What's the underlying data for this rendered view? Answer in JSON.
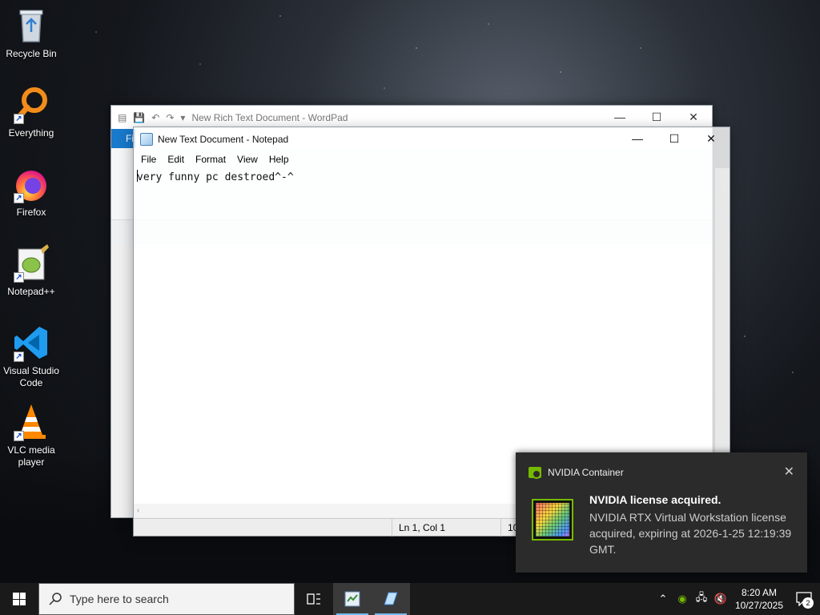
{
  "desktop": {
    "icons": [
      {
        "label": "Recycle Bin"
      },
      {
        "label": "Everything"
      },
      {
        "label": "Firefox"
      },
      {
        "label": "Notepad++"
      },
      {
        "label": "Visual Studio Code"
      },
      {
        "label": "VLC media player"
      }
    ]
  },
  "wordpad": {
    "title": "New Rich Text Document - WordPad",
    "file_tab": "Fi"
  },
  "notepad": {
    "title": "New Text Document - Notepad",
    "menu": [
      "File",
      "Edit",
      "Format",
      "View",
      "Help"
    ],
    "content": "very funny pc destroed^-^",
    "status": {
      "position": "Ln 1, Col 1",
      "zoom": "10"
    }
  },
  "notification": {
    "app": "NVIDIA Container",
    "title": "NVIDIA license acquired.",
    "body": "NVIDIA RTX Virtual Workstation license acquired, expiring at 2026-1-25 12:19:39 GMT."
  },
  "taskbar": {
    "search_placeholder": "Type here to search",
    "time": "8:20 AM",
    "date": "10/27/2025",
    "notification_count": "2"
  },
  "colors": {
    "nvidia_green": "#76b900",
    "taskbar": "#1a1a1a",
    "toast": "#2b2b2b",
    "wordpad_file_tab": "#1979ca"
  }
}
